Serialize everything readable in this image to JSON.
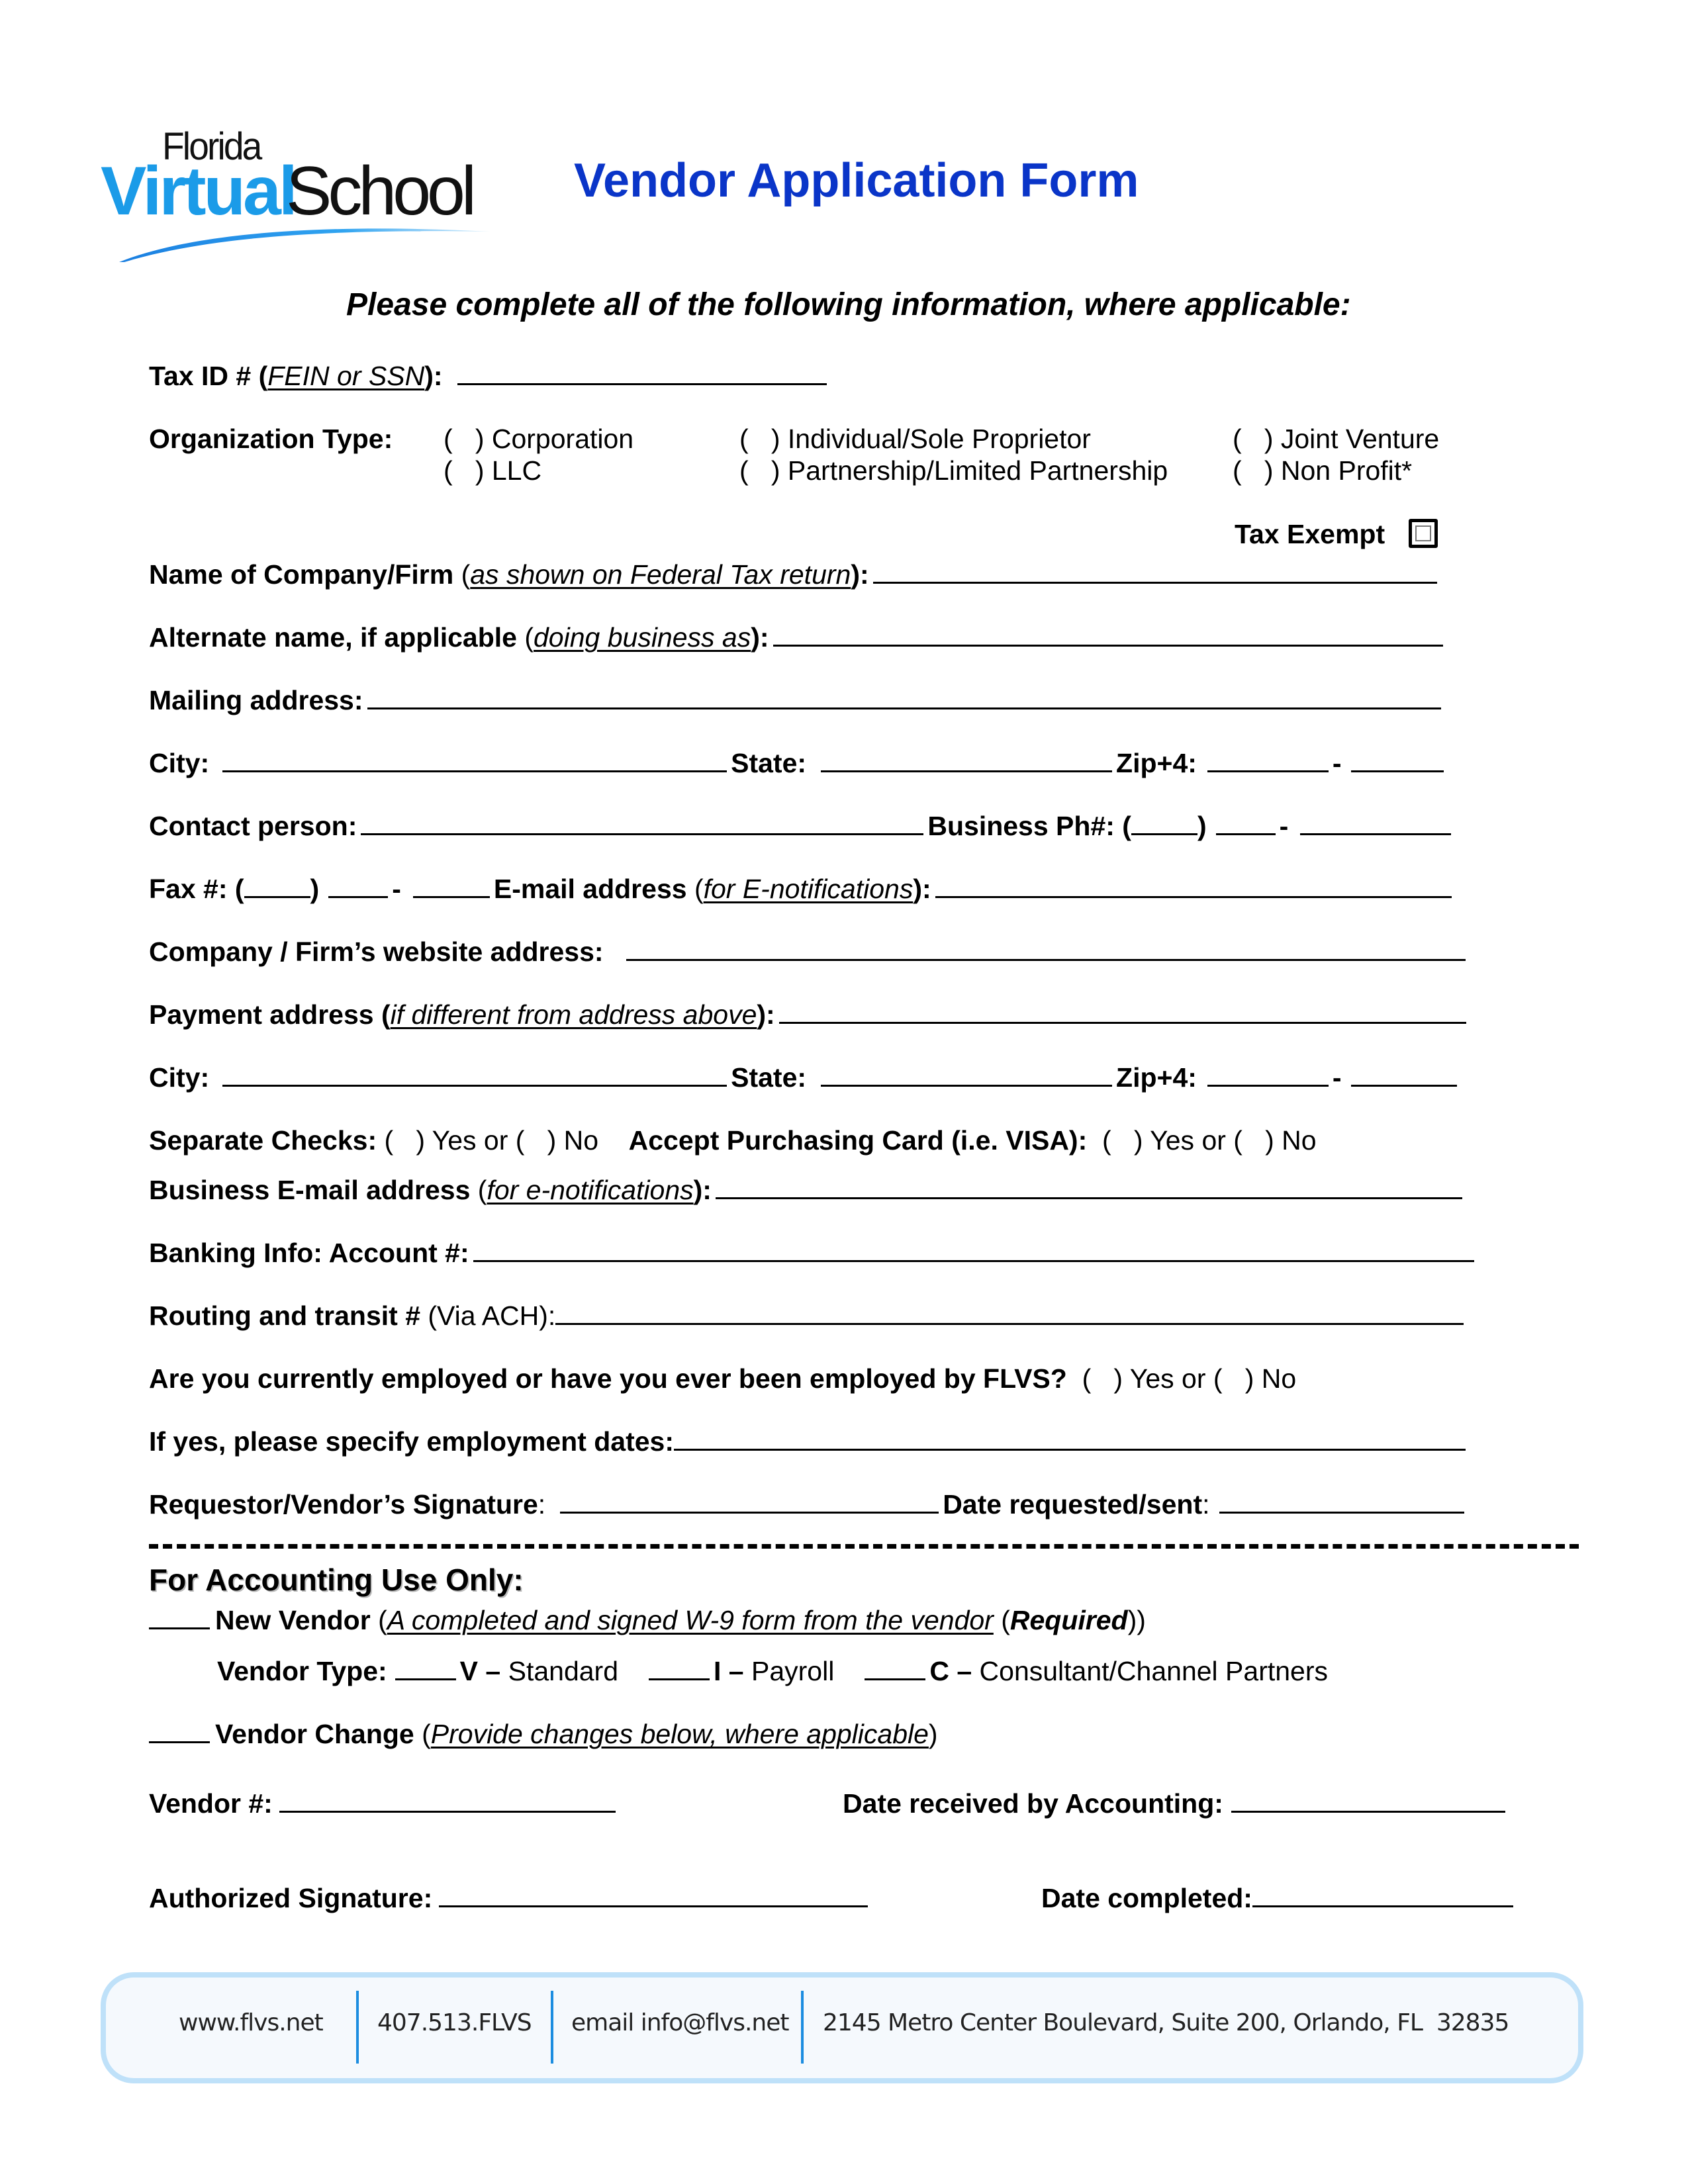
{
  "header": {
    "logo": {
      "line1": "Florida",
      "line2a": "Virtual",
      "line2b": "School"
    },
    "title": "Vendor Application Form",
    "subtitle": "Please complete all of the following information, where applicable:",
    "colors": {
      "title": "#0a35c8",
      "logo_blue": "#1b9be8",
      "footer_border": "#bfe1f9",
      "footer_sep": "#1c8de0"
    }
  },
  "tax_id": {
    "label": "Tax ID # (",
    "hint": "FEIN or SSN",
    "suffix": "):"
  },
  "org_type": {
    "label": "Organization Type:",
    "options": [
      {
        "label": "(   ) Corporation"
      },
      {
        "label": "(   ) LLC"
      },
      {
        "label": "(   ) Individual/Sole Proprietor"
      },
      {
        "label": "(   ) Partnership/Limited Partnership"
      },
      {
        "label": "(   ) Joint Venture"
      },
      {
        "label": "(   ) Non Profit*"
      }
    ],
    "tax_exempt_label": "Tax Exempt"
  },
  "fields": {
    "company_name": {
      "label": "Name of Company/Firm",
      "open": " (",
      "hint": "as shown on Federal Tax return",
      "close": "):"
    },
    "alt_name": {
      "label": "Alternate name, if applicable",
      "open": " (",
      "hint": "doing business as",
      "close": "):"
    },
    "mailing": {
      "label": "Mailing address:"
    },
    "city": {
      "label": "City:"
    },
    "state": {
      "label": "State:"
    },
    "zip": {
      "label": "Zip+4:",
      "dash": "-"
    },
    "contact": {
      "label": "Contact person:"
    },
    "business_ph": {
      "label": "Business Ph#: (",
      "close": ")",
      "dash": "-"
    },
    "fax": {
      "label": "Fax #: (",
      "close": ")",
      "dash": "-"
    },
    "email": {
      "label": "E-mail address",
      "open": " (",
      "hint": "for E-notifications",
      "close": "):"
    },
    "website": {
      "label": "Company / Firm’s website address:"
    },
    "payment_address": {
      "label": "Payment address (",
      "hint": "if different from address above",
      "close": "):"
    },
    "city2": {
      "label": "City:"
    },
    "state2": {
      "label": "State:"
    },
    "zip2": {
      "label": "Zip+4:",
      "dash": "-"
    },
    "separate_checks": {
      "label": "Separate Checks:",
      "options": " (   ) Yes or (   ) No"
    },
    "purchasing_card": {
      "label": "Accept Purchasing Card (i.e. VISA):",
      "options": "  (   ) Yes or (   ) No"
    },
    "business_email": {
      "label": "Business E-mail address",
      "open": " (",
      "hint": "for e-notifications",
      "close": "):"
    },
    "account": {
      "label": "Banking Info: Account #:"
    },
    "routing": {
      "label": "Routing and transit #",
      "hint": " (Via ACH):"
    },
    "employed": {
      "label": "Are you currently employed or have you ever been employed by FLVS?",
      "options": "  (   ) Yes or (   ) No"
    },
    "employment_dates": {
      "label": "If yes, please specify employment dates:"
    },
    "signature": {
      "label": "Requestor/Vendor’s Signature",
      "colon": ":"
    },
    "date_sent": {
      "label": "Date requested/sent",
      "colon": ":"
    }
  },
  "accounting": {
    "title": "For Accounting Use Only:",
    "new_vendor": {
      "label": "New Vendor",
      "open": " (",
      "hint": "A completed and signed W-9 form from the vendor",
      "req_open": " (",
      "required": "Required",
      "req_close": "))"
    },
    "vendor_type": {
      "label": "Vendor Type:",
      "options": [
        {
          "code": "V –",
          "desc": " Standard"
        },
        {
          "code": "I –",
          "desc": " Payroll"
        },
        {
          "code": "C –",
          "desc": " Consultant/Channel Partners"
        }
      ]
    },
    "vendor_change": {
      "label": "Vendor Change",
      "open": " (",
      "hint": "Provide changes below, where applicable",
      "close": ")"
    },
    "vendor_number": {
      "label": "Vendor #:"
    },
    "date_received": {
      "label": "Date received by Accounting:"
    },
    "authorized_signature": {
      "label": "Authorized Signature:"
    },
    "date_completed": {
      "label": "Date completed:"
    }
  },
  "footer": {
    "website": "www.flvs.net",
    "phone": "407.513.FLVS",
    "email": "email info@flvs.net",
    "address": "2145 Metro Center Boulevard, Suite 200, Orlando, FL  32835"
  }
}
